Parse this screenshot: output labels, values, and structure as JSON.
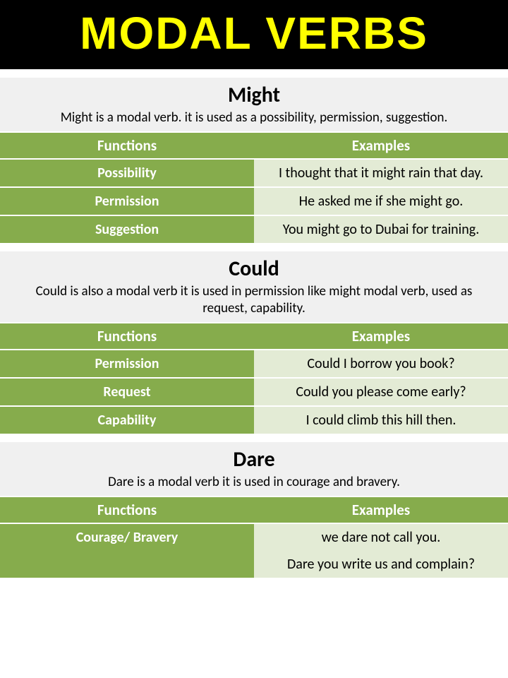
{
  "title": "MODAL VERBS",
  "sections": [
    {
      "heading": "Might",
      "description": "Might is a modal verb. it is used as a possibility, permission, suggestion.",
      "header": {
        "functions": "Functions",
        "examples": "Examples"
      },
      "rows": [
        {
          "function": "Possibility",
          "example": "I thought that it might rain that day."
        },
        {
          "function": "Permission",
          "example": "He asked me if she might go."
        },
        {
          "function": "Suggestion",
          "example": "You might go to Dubai for training."
        }
      ]
    },
    {
      "heading": "Could",
      "description": "Could is also a modal verb it is used in permission like might modal verb, used as request, capability.",
      "header": {
        "functions": "Functions",
        "examples": "Examples"
      },
      "rows": [
        {
          "function": "Permission",
          "example": "Could I borrow you book?"
        },
        {
          "function": "Request",
          "example": "Could you please come early?"
        },
        {
          "function": "Capability",
          "example": "I could climb this hill then."
        }
      ]
    },
    {
      "heading": "Dare",
      "description": "Dare is a modal verb it is used in courage and bravery.",
      "header": {
        "functions": "Functions",
        "examples": "Examples"
      },
      "rows": [
        {
          "function": "Courage/ Bravery",
          "example": "we dare not call you."
        },
        {
          "function": "",
          "example": "Dare you write us and complain?"
        }
      ]
    }
  ]
}
